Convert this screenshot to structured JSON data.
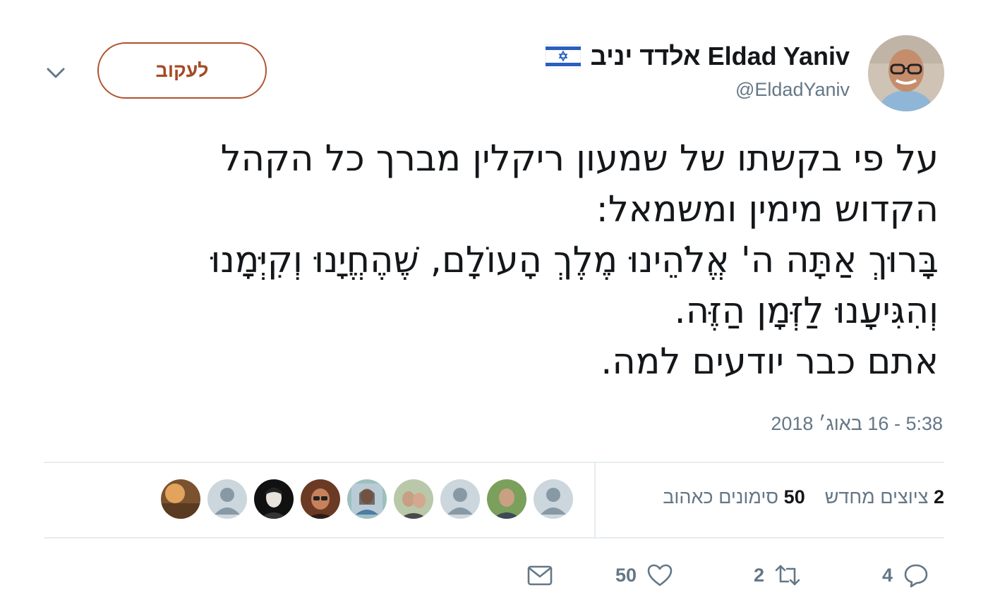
{
  "tweet": {
    "author_name": "Eldad Yaniv אלדד יניב",
    "author_handle": "@EldadYaniv",
    "follow_label": "לעקוב",
    "text_lines": [
      "על פי בקשתו של שמעון ריקלין מברך כל הקהל",
      "הקדוש מימין ומשמאל:",
      "בָּרוּךְ אַתָּה ה' אֱלֹהֵינוּ מֶלֶךְ הָעוֹלָם, שֶׁהֶחֱיָנוּ וְקִיְּמָנוּ",
      "וְהִגִּיעָנוּ לַזְּמָן הַזֶּה.",
      "אתם כבר יודעים למה."
    ],
    "timestamp": "5:38 - 16 באוג׳ 2018"
  },
  "stats": {
    "retweets_count": "2",
    "retweets_label": "ציוצים מחדש",
    "likes_count": "50",
    "likes_label": "סימונים כאהוב"
  },
  "actions": {
    "reply_count": "4",
    "retweet_count": "2",
    "like_count": "50"
  },
  "icons": {
    "caret": "chevron-down-icon",
    "reply": "reply-icon",
    "retweet": "retweet-icon",
    "like": "heart-icon",
    "message": "envelope-icon",
    "flag": "israel-flag-icon"
  },
  "colors": {
    "follow_border": "#b0512d",
    "secondary_text": "#657786",
    "primary_text": "#14171a",
    "divider": "#e6ecf0",
    "flag_blue": "#2b5ebe"
  }
}
